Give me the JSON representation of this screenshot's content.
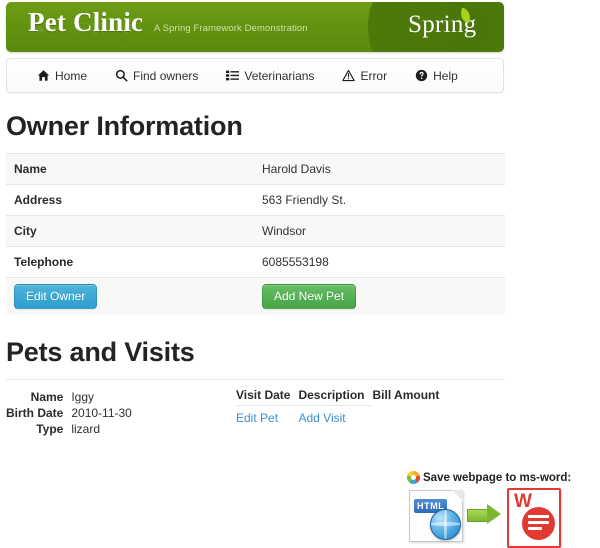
{
  "header": {
    "brand_title": "Pet Clinic",
    "tagline": "A Spring Framework Demonstration",
    "logo_text": "Spring"
  },
  "nav": {
    "items": [
      {
        "label": "Home",
        "icon": "home-icon"
      },
      {
        "label": "Find owners",
        "icon": "search-icon"
      },
      {
        "label": "Veterinarians",
        "icon": "list-icon"
      },
      {
        "label": "Error",
        "icon": "warning-triangle-icon"
      },
      {
        "label": "Help",
        "icon": "question-circle-icon"
      }
    ]
  },
  "owner_section": {
    "title": "Owner Information",
    "rows": [
      {
        "label": "Name",
        "value": "Harold Davis"
      },
      {
        "label": "Address",
        "value": "563 Friendly St."
      },
      {
        "label": "City",
        "value": "Windsor"
      },
      {
        "label": "Telephone",
        "value": "6085553198"
      }
    ],
    "edit_owner_label": "Edit Owner",
    "add_new_pet_label": "Add New Pet",
    "edit_owner_color": "#2f9fce",
    "add_new_pet_color": "#47a447"
  },
  "pets_section": {
    "title": "Pets and Visits",
    "pet": {
      "name_label": "Name",
      "name_value": "Iggy",
      "birth_date_label": "Birth Date",
      "birth_date_value": "2010-11-30",
      "type_label": "Type",
      "type_value": "lizard"
    },
    "visits_headers": [
      "Visit Date",
      "Description",
      "Bill Amount"
    ],
    "links": [
      {
        "label": "Edit Pet",
        "color": "#3d8fd1"
      },
      {
        "label": "Add Visit",
        "color": "#3d8fd1"
      }
    ]
  },
  "msword_widget": {
    "caption": "Save webpage to ms-word:",
    "source_badge": "HTML",
    "target_letter": "W"
  }
}
